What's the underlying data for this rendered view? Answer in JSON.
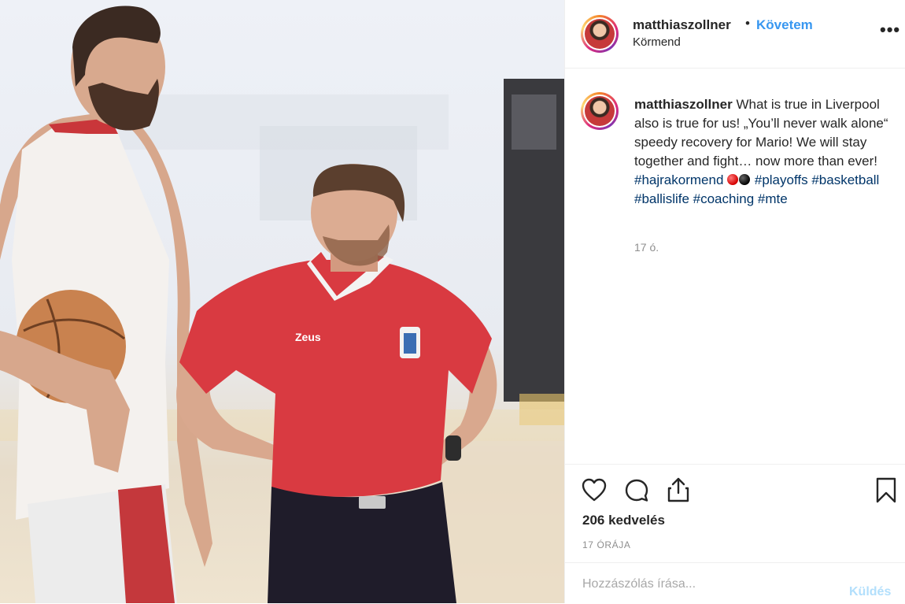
{
  "post": {
    "username": "matthiaszollner",
    "separator": "•",
    "follow_label": "Követem",
    "location": "Körmend",
    "more_icon": "more-options-icon"
  },
  "caption": {
    "username": "matthiaszollner",
    "text1": "What is true in Liverpool also is true for us! „You’ll never walk alone“ speedy recovery for Mario! We will stay together and fight… now more than ever!",
    "tag1": "#hajrakormend",
    "tags2": "#playoffs #basketball #ballislife #coaching #mte",
    "emoji": [
      "red-circle",
      "black-circle"
    ],
    "time": "17 ó."
  },
  "photo_text": {
    "shirt_brand": "Zeus"
  },
  "actions": {
    "icons": [
      "heart-icon",
      "comment-icon",
      "share-icon",
      "bookmark-icon"
    ]
  },
  "likes": "206 kedvelés",
  "time_ago": "17 ÓRÁJA",
  "comment": {
    "placeholder": "Hozzászólás írása...",
    "send_label": "Küldés"
  },
  "colors": {
    "accent": "#3897f0",
    "hashtag": "#003569",
    "muted": "#8e8e8e",
    "send_disabled": "#b2dffc",
    "shirt_red": "#d93a41"
  }
}
